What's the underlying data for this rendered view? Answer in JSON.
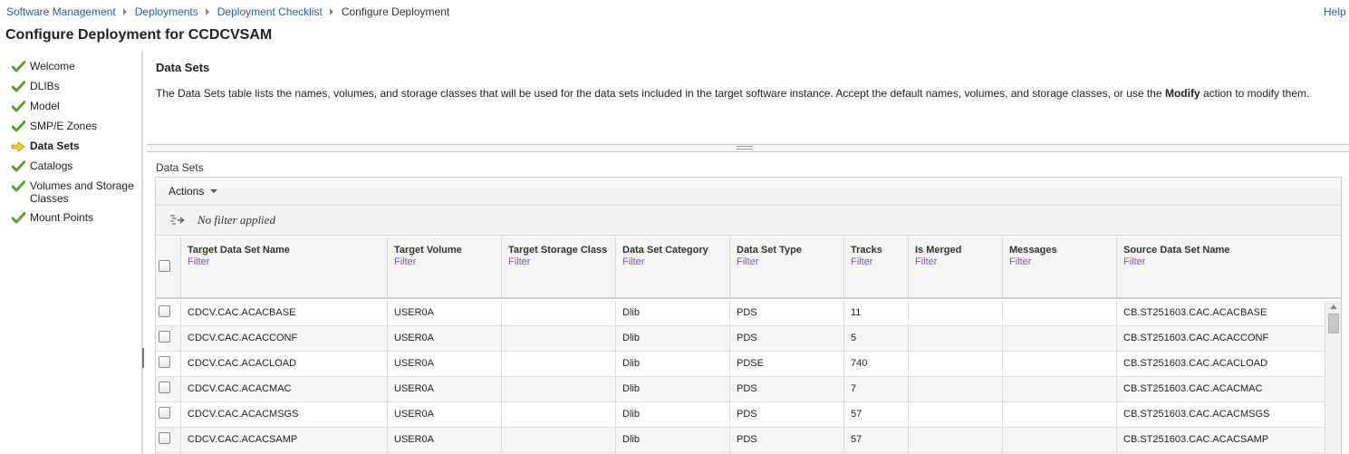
{
  "breadcrumb": {
    "items": [
      "Software Management",
      "Deployments",
      "Deployment Checklist"
    ],
    "current": "Configure Deployment"
  },
  "help_label": "Help",
  "page_title": "Configure Deployment for CCDCVSAM",
  "nav": {
    "items": [
      {
        "label": "Welcome",
        "status": "complete",
        "icon": "check-icon"
      },
      {
        "label": "DLIBs",
        "status": "complete",
        "icon": "check-icon"
      },
      {
        "label": "Model",
        "status": "complete",
        "icon": "check-icon"
      },
      {
        "label": "SMP/E Zones",
        "status": "complete",
        "icon": "check-icon"
      },
      {
        "label": "Data Sets",
        "status": "current",
        "icon": "arrow-right-icon"
      },
      {
        "label": "Catalogs",
        "status": "complete",
        "icon": "check-icon"
      },
      {
        "label": "Volumes and Storage Classes",
        "status": "complete",
        "icon": "check-icon"
      },
      {
        "label": "Mount Points",
        "status": "complete",
        "icon": "check-icon"
      }
    ]
  },
  "section": {
    "title": "Data Sets",
    "desc_before": "The Data Sets table lists the names, volumes, and storage classes that will be used for the data sets included in the target software instance.  Accept the default names, volumes, and storage classes, or use the ",
    "desc_bold": "Modify",
    "desc_after": " action to modify them."
  },
  "table": {
    "caption": "Data Sets",
    "actions_label": "Actions",
    "filter_status": "No filter applied",
    "filter_link": "Filter",
    "columns": [
      "Target Data Set Name",
      "Target Volume",
      "Target Storage Class",
      "Data Set Category",
      "Data Set Type",
      "Tracks",
      "Is Merged",
      "Messages",
      "Source Data Set Name"
    ],
    "rows": [
      [
        "CDCV.CAC.ACACBASE",
        "USER0A",
        "",
        "Dlib",
        "PDS",
        "11",
        "",
        "",
        "CB.ST251603.CAC.ACACBASE"
      ],
      [
        "CDCV.CAC.ACACCONF",
        "USER0A",
        "",
        "Dlib",
        "PDS",
        "5",
        "",
        "",
        "CB.ST251603.CAC.ACACCONF"
      ],
      [
        "CDCV.CAC.ACACLOAD",
        "USER0A",
        "",
        "Dlib",
        "PDSE",
        "740",
        "",
        "",
        "CB.ST251603.CAC.ACACLOAD"
      ],
      [
        "CDCV.CAC.ACACMAC",
        "USER0A",
        "",
        "Dlib",
        "PDS",
        "7",
        "",
        "",
        "CB.ST251603.CAC.ACACMAC"
      ],
      [
        "CDCV.CAC.ACACMSGS",
        "USER0A",
        "",
        "Dlib",
        "PDS",
        "57",
        "",
        "",
        "CB.ST251603.CAC.ACACMSGS"
      ],
      [
        "CDCV.CAC.ACACSAMP",
        "USER0A",
        "",
        "Dlib",
        "PDS",
        "57",
        "",
        "",
        "CB.ST251603.CAC.ACACSAMP"
      ]
    ]
  },
  "colors": {
    "link": "#2a5d9f",
    "check": "#5aa02c",
    "current_arrow": "#f2c81e",
    "filter_link": "#7a5aa0"
  }
}
